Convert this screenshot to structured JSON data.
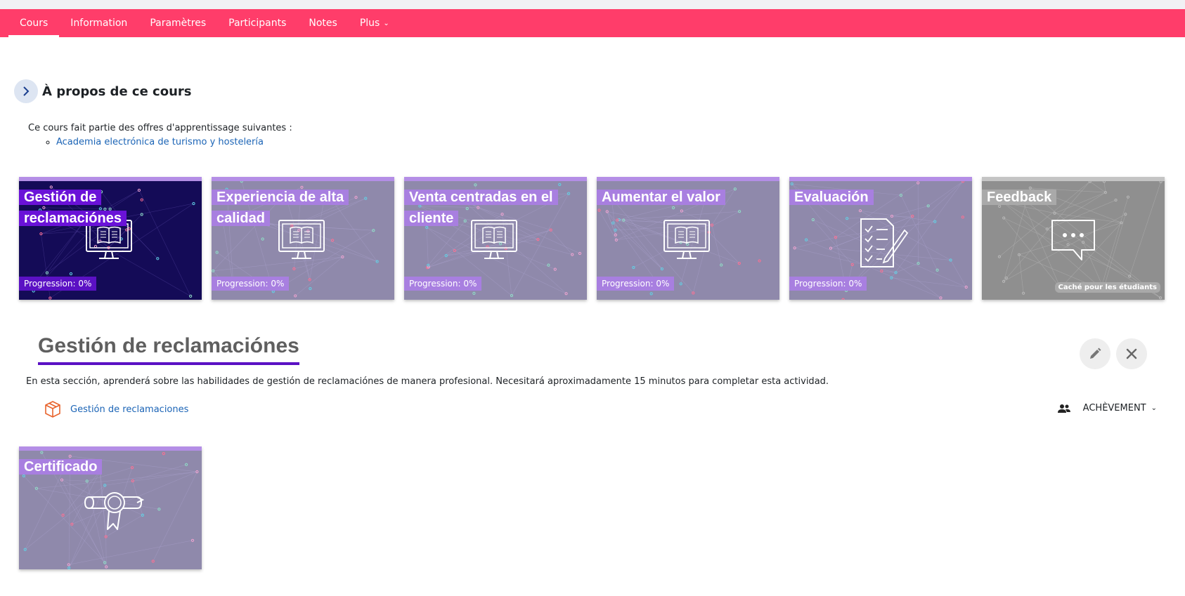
{
  "nav": {
    "tabs": [
      {
        "label": "Cours",
        "active": true
      },
      {
        "label": "Information"
      },
      {
        "label": "Paramètres"
      },
      {
        "label": "Participants"
      },
      {
        "label": "Notes"
      },
      {
        "label": "Plus"
      }
    ],
    "more_caret": "⌄"
  },
  "about": {
    "title": "À propos de ce cours",
    "toggle_icon": "chevron-right-icon",
    "intro": "Ce cours fait partie des offres d'apprentissage suivantes :",
    "offers": [
      "Academia electrónica de turismo y hostelería"
    ]
  },
  "tiles": [
    {
      "title": "Gestión de reclamaciónes",
      "progress": "Progression: 0%",
      "icon": "monitor-book-icon",
      "state": "active"
    },
    {
      "title": "Experiencia de alta calidad",
      "progress": "Progression: 0%",
      "icon": "monitor-book-icon"
    },
    {
      "title": "Venta centradas en el cliente",
      "progress": "Progression: 0%",
      "icon": "monitor-book-icon"
    },
    {
      "title": "Aumentar el valor",
      "progress": "Progression: 0%",
      "icon": "monitor-book-icon"
    },
    {
      "title": "Evaluación",
      "progress": "Progression: 0%",
      "icon": "checklist-pencil-icon"
    },
    {
      "title": "Feedback",
      "badge": "Caché pour les étudiants",
      "icon": "chat-bubble-icon",
      "state": "hidden"
    }
  ],
  "section": {
    "title": "Gestión de reclamaciónes",
    "description": "En esta sección, aprenderá sobre las habilidades de gestión de reclamaciónes de manera profesional. Necesitará aproximadamente 15 minutos para completar esta actividad.",
    "activity": {
      "label": "Gestión de reclamaciones",
      "icon": "package-icon"
    },
    "completion_label": "ACHÈVEMENT",
    "completion_caret": "⌄",
    "edit_icon": "pencil-icon",
    "close_icon": "close-icon",
    "group_icon": "users-icon"
  },
  "certificate_tile": {
    "title": "Certificado",
    "icon": "diploma-ribbon-icon"
  },
  "colors": {
    "navbar": "#ff3d6a",
    "tile_accent": "#a87fe0",
    "tile_active_bg": "#140b57",
    "tile_active_label": "#6a12d8",
    "section_underline": "#5b11c4",
    "link": "#1b64b6",
    "activity_icon": "#e8632c"
  }
}
